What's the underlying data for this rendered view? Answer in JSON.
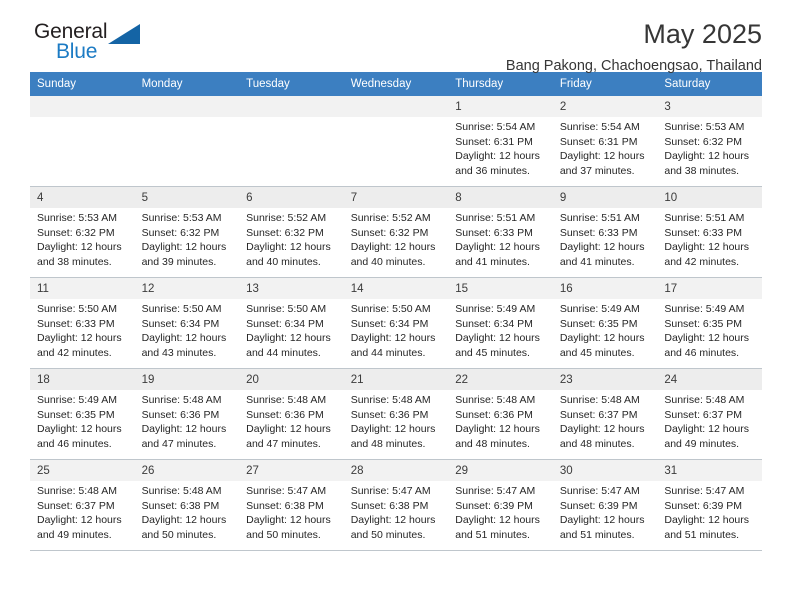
{
  "brand": {
    "name_part1": "General",
    "name_part2": "Blue",
    "triangle_color": "#1464a5",
    "blue_text_color": "#1c7bc4"
  },
  "header": {
    "title": "May 2025",
    "subtitle": "Bang Pakong, Chachoengsao, Thailand"
  },
  "theme": {
    "header_row_bg": "#3c7fc1",
    "header_row_text": "#ffffff",
    "row_shade_bg": "#f2f2f2",
    "cell_border": "#bfc6cc"
  },
  "weekdays": [
    "Sunday",
    "Monday",
    "Tuesday",
    "Wednesday",
    "Thursday",
    "Friday",
    "Saturday"
  ],
  "weeks": [
    [
      {
        "day": "",
        "sunrise": "",
        "sunset": "",
        "daylight_line1": "",
        "daylight_line2": ""
      },
      {
        "day": "",
        "sunrise": "",
        "sunset": "",
        "daylight_line1": "",
        "daylight_line2": ""
      },
      {
        "day": "",
        "sunrise": "",
        "sunset": "",
        "daylight_line1": "",
        "daylight_line2": ""
      },
      {
        "day": "",
        "sunrise": "",
        "sunset": "",
        "daylight_line1": "",
        "daylight_line2": ""
      },
      {
        "day": "1",
        "sunrise": "Sunrise: 5:54 AM",
        "sunset": "Sunset: 6:31 PM",
        "daylight_line1": "Daylight: 12 hours",
        "daylight_line2": "and 36 minutes."
      },
      {
        "day": "2",
        "sunrise": "Sunrise: 5:54 AM",
        "sunset": "Sunset: 6:31 PM",
        "daylight_line1": "Daylight: 12 hours",
        "daylight_line2": "and 37 minutes."
      },
      {
        "day": "3",
        "sunrise": "Sunrise: 5:53 AM",
        "sunset": "Sunset: 6:32 PM",
        "daylight_line1": "Daylight: 12 hours",
        "daylight_line2": "and 38 minutes."
      }
    ],
    [
      {
        "day": "4",
        "sunrise": "Sunrise: 5:53 AM",
        "sunset": "Sunset: 6:32 PM",
        "daylight_line1": "Daylight: 12 hours",
        "daylight_line2": "and 38 minutes."
      },
      {
        "day": "5",
        "sunrise": "Sunrise: 5:53 AM",
        "sunset": "Sunset: 6:32 PM",
        "daylight_line1": "Daylight: 12 hours",
        "daylight_line2": "and 39 minutes."
      },
      {
        "day": "6",
        "sunrise": "Sunrise: 5:52 AM",
        "sunset": "Sunset: 6:32 PM",
        "daylight_line1": "Daylight: 12 hours",
        "daylight_line2": "and 40 minutes."
      },
      {
        "day": "7",
        "sunrise": "Sunrise: 5:52 AM",
        "sunset": "Sunset: 6:32 PM",
        "daylight_line1": "Daylight: 12 hours",
        "daylight_line2": "and 40 minutes."
      },
      {
        "day": "8",
        "sunrise": "Sunrise: 5:51 AM",
        "sunset": "Sunset: 6:33 PM",
        "daylight_line1": "Daylight: 12 hours",
        "daylight_line2": "and 41 minutes."
      },
      {
        "day": "9",
        "sunrise": "Sunrise: 5:51 AM",
        "sunset": "Sunset: 6:33 PM",
        "daylight_line1": "Daylight: 12 hours",
        "daylight_line2": "and 41 minutes."
      },
      {
        "day": "10",
        "sunrise": "Sunrise: 5:51 AM",
        "sunset": "Sunset: 6:33 PM",
        "daylight_line1": "Daylight: 12 hours",
        "daylight_line2": "and 42 minutes."
      }
    ],
    [
      {
        "day": "11",
        "sunrise": "Sunrise: 5:50 AM",
        "sunset": "Sunset: 6:33 PM",
        "daylight_line1": "Daylight: 12 hours",
        "daylight_line2": "and 42 minutes."
      },
      {
        "day": "12",
        "sunrise": "Sunrise: 5:50 AM",
        "sunset": "Sunset: 6:34 PM",
        "daylight_line1": "Daylight: 12 hours",
        "daylight_line2": "and 43 minutes."
      },
      {
        "day": "13",
        "sunrise": "Sunrise: 5:50 AM",
        "sunset": "Sunset: 6:34 PM",
        "daylight_line1": "Daylight: 12 hours",
        "daylight_line2": "and 44 minutes."
      },
      {
        "day": "14",
        "sunrise": "Sunrise: 5:50 AM",
        "sunset": "Sunset: 6:34 PM",
        "daylight_line1": "Daylight: 12 hours",
        "daylight_line2": "and 44 minutes."
      },
      {
        "day": "15",
        "sunrise": "Sunrise: 5:49 AM",
        "sunset": "Sunset: 6:34 PM",
        "daylight_line1": "Daylight: 12 hours",
        "daylight_line2": "and 45 minutes."
      },
      {
        "day": "16",
        "sunrise": "Sunrise: 5:49 AM",
        "sunset": "Sunset: 6:35 PM",
        "daylight_line1": "Daylight: 12 hours",
        "daylight_line2": "and 45 minutes."
      },
      {
        "day": "17",
        "sunrise": "Sunrise: 5:49 AM",
        "sunset": "Sunset: 6:35 PM",
        "daylight_line1": "Daylight: 12 hours",
        "daylight_line2": "and 46 minutes."
      }
    ],
    [
      {
        "day": "18",
        "sunrise": "Sunrise: 5:49 AM",
        "sunset": "Sunset: 6:35 PM",
        "daylight_line1": "Daylight: 12 hours",
        "daylight_line2": "and 46 minutes."
      },
      {
        "day": "19",
        "sunrise": "Sunrise: 5:48 AM",
        "sunset": "Sunset: 6:36 PM",
        "daylight_line1": "Daylight: 12 hours",
        "daylight_line2": "and 47 minutes."
      },
      {
        "day": "20",
        "sunrise": "Sunrise: 5:48 AM",
        "sunset": "Sunset: 6:36 PM",
        "daylight_line1": "Daylight: 12 hours",
        "daylight_line2": "and 47 minutes."
      },
      {
        "day": "21",
        "sunrise": "Sunrise: 5:48 AM",
        "sunset": "Sunset: 6:36 PM",
        "daylight_line1": "Daylight: 12 hours",
        "daylight_line2": "and 48 minutes."
      },
      {
        "day": "22",
        "sunrise": "Sunrise: 5:48 AM",
        "sunset": "Sunset: 6:36 PM",
        "daylight_line1": "Daylight: 12 hours",
        "daylight_line2": "and 48 minutes."
      },
      {
        "day": "23",
        "sunrise": "Sunrise: 5:48 AM",
        "sunset": "Sunset: 6:37 PM",
        "daylight_line1": "Daylight: 12 hours",
        "daylight_line2": "and 48 minutes."
      },
      {
        "day": "24",
        "sunrise": "Sunrise: 5:48 AM",
        "sunset": "Sunset: 6:37 PM",
        "daylight_line1": "Daylight: 12 hours",
        "daylight_line2": "and 49 minutes."
      }
    ],
    [
      {
        "day": "25",
        "sunrise": "Sunrise: 5:48 AM",
        "sunset": "Sunset: 6:37 PM",
        "daylight_line1": "Daylight: 12 hours",
        "daylight_line2": "and 49 minutes."
      },
      {
        "day": "26",
        "sunrise": "Sunrise: 5:48 AM",
        "sunset": "Sunset: 6:38 PM",
        "daylight_line1": "Daylight: 12 hours",
        "daylight_line2": "and 50 minutes."
      },
      {
        "day": "27",
        "sunrise": "Sunrise: 5:47 AM",
        "sunset": "Sunset: 6:38 PM",
        "daylight_line1": "Daylight: 12 hours",
        "daylight_line2": "and 50 minutes."
      },
      {
        "day": "28",
        "sunrise": "Sunrise: 5:47 AM",
        "sunset": "Sunset: 6:38 PM",
        "daylight_line1": "Daylight: 12 hours",
        "daylight_line2": "and 50 minutes."
      },
      {
        "day": "29",
        "sunrise": "Sunrise: 5:47 AM",
        "sunset": "Sunset: 6:39 PM",
        "daylight_line1": "Daylight: 12 hours",
        "daylight_line2": "and 51 minutes."
      },
      {
        "day": "30",
        "sunrise": "Sunrise: 5:47 AM",
        "sunset": "Sunset: 6:39 PM",
        "daylight_line1": "Daylight: 12 hours",
        "daylight_line2": "and 51 minutes."
      },
      {
        "day": "31",
        "sunrise": "Sunrise: 5:47 AM",
        "sunset": "Sunset: 6:39 PM",
        "daylight_line1": "Daylight: 12 hours",
        "daylight_line2": "and 51 minutes."
      }
    ]
  ]
}
